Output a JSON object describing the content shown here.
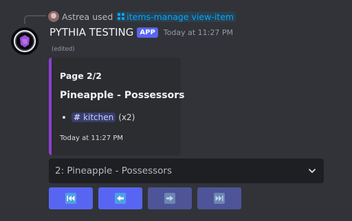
{
  "reply": {
    "user": "Astrea",
    "action_text": "used",
    "command": "items-manage view-item"
  },
  "message": {
    "author": "PYTHIA TESTING",
    "badge": "APP",
    "timestamp": "Today at 11:27 PM",
    "edited_label": "(edited)"
  },
  "embed": {
    "accent_color": "#8f3fd1",
    "page": "Page 2/2",
    "title": "Pineapple - Possessors",
    "items": [
      {
        "channel": "kitchen",
        "count": "(x2)"
      }
    ],
    "footer": "Today at 11:27 PM"
  },
  "select": {
    "value": "2: Pineapple - Possessors"
  },
  "buttons": [
    {
      "icon": "first-page-icon",
      "enabled": true
    },
    {
      "icon": "previous-page-icon",
      "enabled": true
    },
    {
      "icon": "next-page-icon",
      "enabled": false
    },
    {
      "icon": "last-page-icon",
      "enabled": false
    }
  ],
  "colors": {
    "background": "#313338",
    "blurple": "#5865f2",
    "link": "#00a8fc"
  }
}
